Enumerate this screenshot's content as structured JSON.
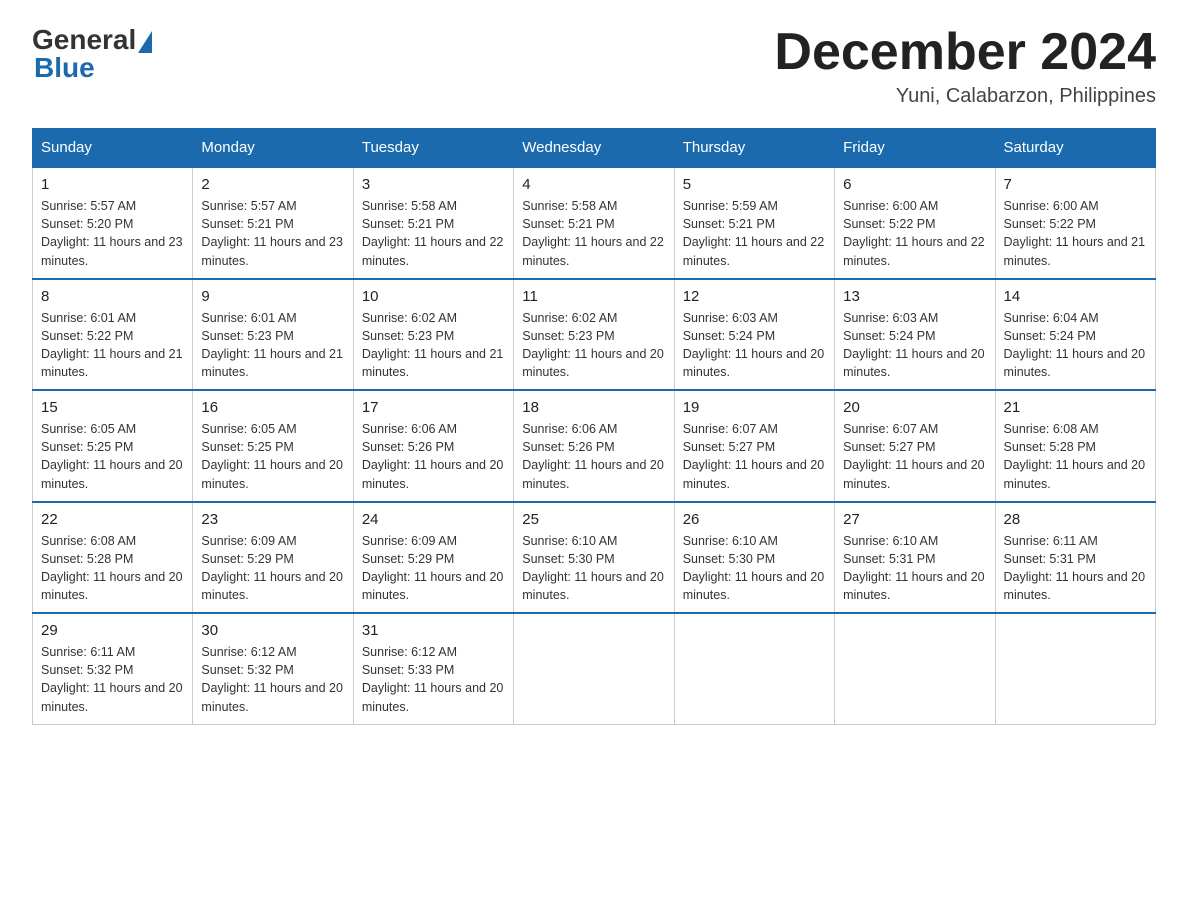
{
  "header": {
    "logo_general": "General",
    "logo_blue": "Blue",
    "title": "December 2024",
    "subtitle": "Yuni, Calabarzon, Philippines"
  },
  "days_of_week": [
    "Sunday",
    "Monday",
    "Tuesday",
    "Wednesday",
    "Thursday",
    "Friday",
    "Saturday"
  ],
  "weeks": [
    [
      {
        "num": "1",
        "sunrise": "5:57 AM",
        "sunset": "5:20 PM",
        "daylight": "11 hours and 23 minutes."
      },
      {
        "num": "2",
        "sunrise": "5:57 AM",
        "sunset": "5:21 PM",
        "daylight": "11 hours and 23 minutes."
      },
      {
        "num": "3",
        "sunrise": "5:58 AM",
        "sunset": "5:21 PM",
        "daylight": "11 hours and 22 minutes."
      },
      {
        "num": "4",
        "sunrise": "5:58 AM",
        "sunset": "5:21 PM",
        "daylight": "11 hours and 22 minutes."
      },
      {
        "num": "5",
        "sunrise": "5:59 AM",
        "sunset": "5:21 PM",
        "daylight": "11 hours and 22 minutes."
      },
      {
        "num": "6",
        "sunrise": "6:00 AM",
        "sunset": "5:22 PM",
        "daylight": "11 hours and 22 minutes."
      },
      {
        "num": "7",
        "sunrise": "6:00 AM",
        "sunset": "5:22 PM",
        "daylight": "11 hours and 21 minutes."
      }
    ],
    [
      {
        "num": "8",
        "sunrise": "6:01 AM",
        "sunset": "5:22 PM",
        "daylight": "11 hours and 21 minutes."
      },
      {
        "num": "9",
        "sunrise": "6:01 AM",
        "sunset": "5:23 PM",
        "daylight": "11 hours and 21 minutes."
      },
      {
        "num": "10",
        "sunrise": "6:02 AM",
        "sunset": "5:23 PM",
        "daylight": "11 hours and 21 minutes."
      },
      {
        "num": "11",
        "sunrise": "6:02 AM",
        "sunset": "5:23 PM",
        "daylight": "11 hours and 20 minutes."
      },
      {
        "num": "12",
        "sunrise": "6:03 AM",
        "sunset": "5:24 PM",
        "daylight": "11 hours and 20 minutes."
      },
      {
        "num": "13",
        "sunrise": "6:03 AM",
        "sunset": "5:24 PM",
        "daylight": "11 hours and 20 minutes."
      },
      {
        "num": "14",
        "sunrise": "6:04 AM",
        "sunset": "5:24 PM",
        "daylight": "11 hours and 20 minutes."
      }
    ],
    [
      {
        "num": "15",
        "sunrise": "6:05 AM",
        "sunset": "5:25 PM",
        "daylight": "11 hours and 20 minutes."
      },
      {
        "num": "16",
        "sunrise": "6:05 AM",
        "sunset": "5:25 PM",
        "daylight": "11 hours and 20 minutes."
      },
      {
        "num": "17",
        "sunrise": "6:06 AM",
        "sunset": "5:26 PM",
        "daylight": "11 hours and 20 minutes."
      },
      {
        "num": "18",
        "sunrise": "6:06 AM",
        "sunset": "5:26 PM",
        "daylight": "11 hours and 20 minutes."
      },
      {
        "num": "19",
        "sunrise": "6:07 AM",
        "sunset": "5:27 PM",
        "daylight": "11 hours and 20 minutes."
      },
      {
        "num": "20",
        "sunrise": "6:07 AM",
        "sunset": "5:27 PM",
        "daylight": "11 hours and 20 minutes."
      },
      {
        "num": "21",
        "sunrise": "6:08 AM",
        "sunset": "5:28 PM",
        "daylight": "11 hours and 20 minutes."
      }
    ],
    [
      {
        "num": "22",
        "sunrise": "6:08 AM",
        "sunset": "5:28 PM",
        "daylight": "11 hours and 20 minutes."
      },
      {
        "num": "23",
        "sunrise": "6:09 AM",
        "sunset": "5:29 PM",
        "daylight": "11 hours and 20 minutes."
      },
      {
        "num": "24",
        "sunrise": "6:09 AM",
        "sunset": "5:29 PM",
        "daylight": "11 hours and 20 minutes."
      },
      {
        "num": "25",
        "sunrise": "6:10 AM",
        "sunset": "5:30 PM",
        "daylight": "11 hours and 20 minutes."
      },
      {
        "num": "26",
        "sunrise": "6:10 AM",
        "sunset": "5:30 PM",
        "daylight": "11 hours and 20 minutes."
      },
      {
        "num": "27",
        "sunrise": "6:10 AM",
        "sunset": "5:31 PM",
        "daylight": "11 hours and 20 minutes."
      },
      {
        "num": "28",
        "sunrise": "6:11 AM",
        "sunset": "5:31 PM",
        "daylight": "11 hours and 20 minutes."
      }
    ],
    [
      {
        "num": "29",
        "sunrise": "6:11 AM",
        "sunset": "5:32 PM",
        "daylight": "11 hours and 20 minutes."
      },
      {
        "num": "30",
        "sunrise": "6:12 AM",
        "sunset": "5:32 PM",
        "daylight": "11 hours and 20 minutes."
      },
      {
        "num": "31",
        "sunrise": "6:12 AM",
        "sunset": "5:33 PM",
        "daylight": "11 hours and 20 minutes."
      },
      null,
      null,
      null,
      null
    ]
  ],
  "accent_color": "#1a6aad"
}
